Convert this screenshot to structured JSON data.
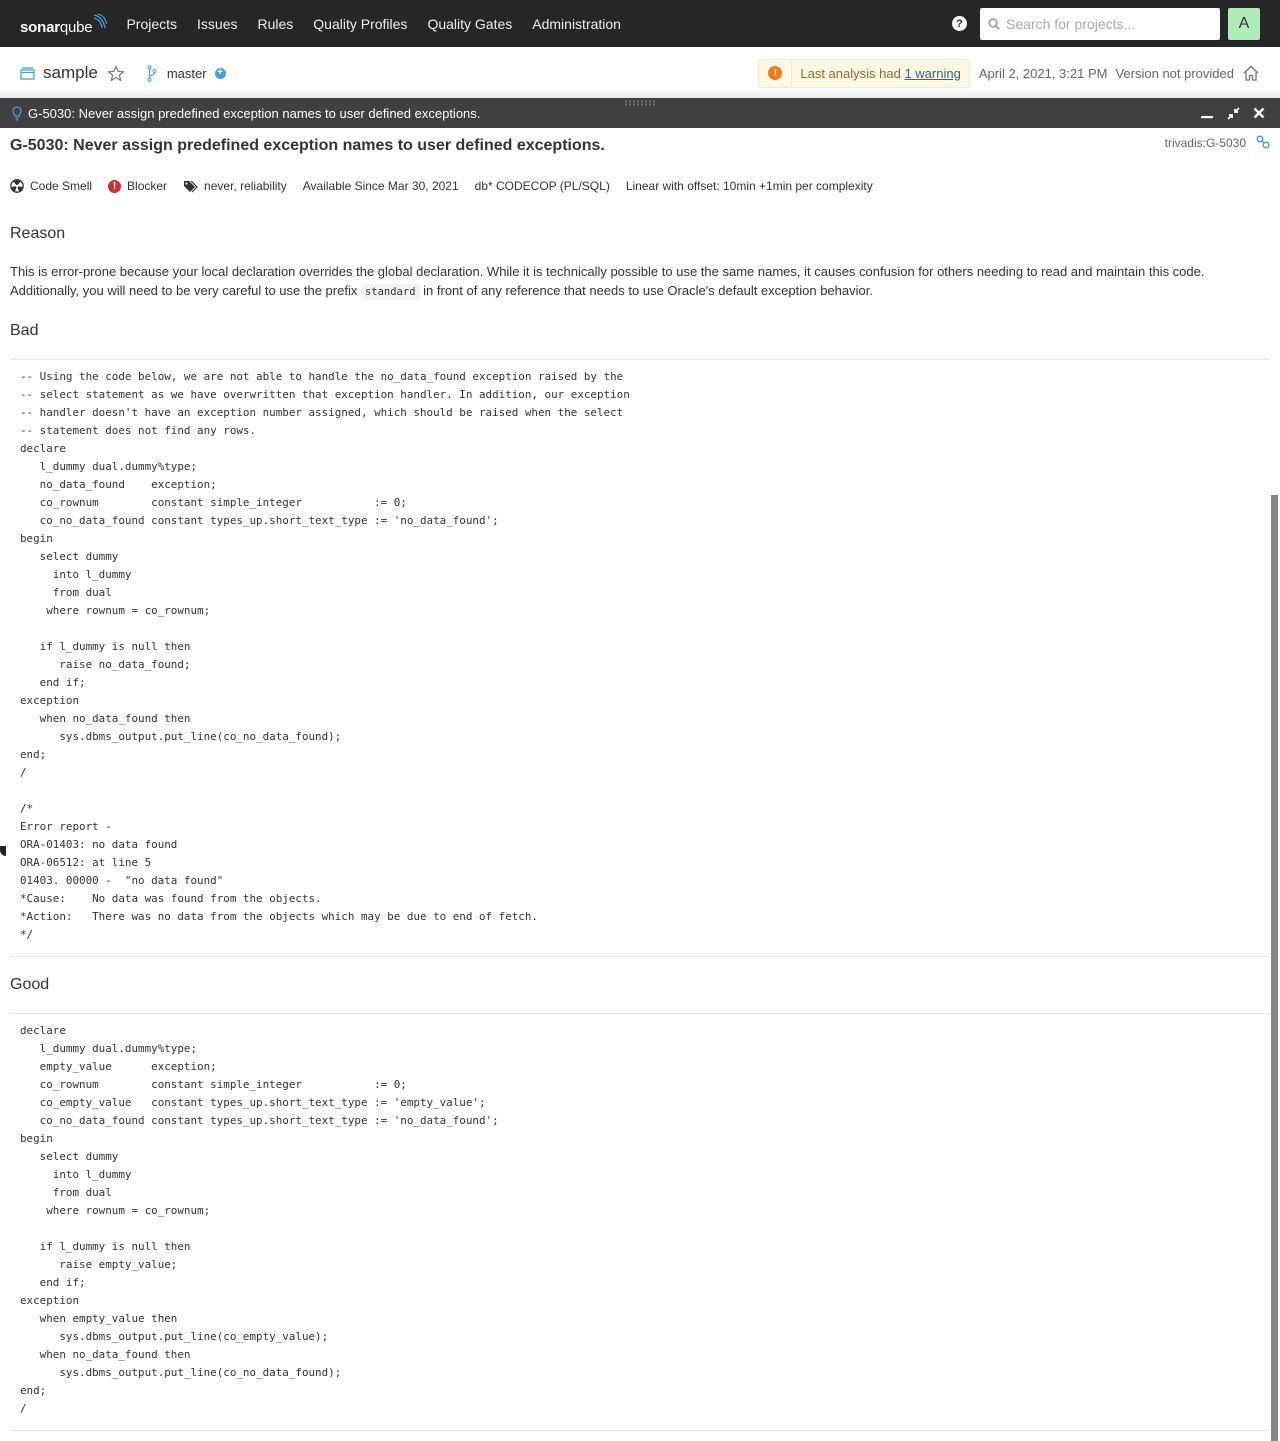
{
  "navbar": {
    "logo_bold": "sonar",
    "logo_light": "qube",
    "links": [
      "Projects",
      "Issues",
      "Rules",
      "Quality Profiles",
      "Quality Gates",
      "Administration"
    ],
    "search_placeholder": "Search for projects...",
    "search_value": "",
    "avatar_letter": "A"
  },
  "project": {
    "name": "sample",
    "branch": "master",
    "warning_prefix": "Last analysis had ",
    "warning_link": "1 warning",
    "analysis_date": "April 2, 2021, 3:21 PM",
    "version": "Version not provided"
  },
  "workspace": {
    "title": "G-5030: Never assign predefined exception names to user defined exceptions."
  },
  "rule": {
    "title": "G-5030: Never assign predefined exception names to user defined exceptions.",
    "key": "trivadis:G-5030",
    "type": "Code Smell",
    "severity": "Blocker",
    "tags": "never, reliability",
    "available_since": "Available Since Mar 30, 2021",
    "repository": "db* CODECOP (PL/SQL)",
    "remediation": "Linear with offset: 10min +1min per complexity",
    "sections": {
      "reason_heading": "Reason",
      "reason_text_1": "This is error-prone because your local declaration overrides the global declaration. While it is technically possible to use the same names, it causes confusion for others needing to read and maintain this code.",
      "reason_text_2a": "Additionally, you will need to be very careful to use the prefix ",
      "reason_code": "standard",
      "reason_text_2b": " in front of any reference that needs to use Oracle's default exception behavior.",
      "bad_heading": "Bad",
      "bad_code": "-- Using the code below, we are not able to handle the no_data_found exception raised by the\n-- select statement as we have overwritten that exception handler. In addition, our exception\n-- handler doesn't have an exception number assigned, which should be raised when the select\n-- statement does not find any rows.\ndeclare\n   l_dummy dual.dummy%type;\n   no_data_found    exception;\n   co_rownum        constant simple_integer           := 0;\n   co_no_data_found constant types_up.short_text_type := 'no_data_found';\nbegin\n   select dummy\n     into l_dummy\n     from dual\n    where rownum = co_rownum;\n\n   if l_dummy is null then\n      raise no_data_found;\n   end if;\nexception\n   when no_data_found then\n      sys.dbms_output.put_line(co_no_data_found);\nend;\n/\n\n/*\nError report -\nORA-01403: no data found\nORA-06512: at line 5\n01403. 00000 -  \"no data found\"\n*Cause:    No data was found from the objects.\n*Action:   There was no data from the objects which may be due to end of fetch.\n*/",
      "good_heading": "Good",
      "good_code": "declare\n   l_dummy dual.dummy%type;\n   empty_value      exception;\n   co_rownum        constant simple_integer           := 0;\n   co_empty_value   constant types_up.short_text_type := 'empty_value';\n   co_no_data_found constant types_up.short_text_type := 'no_data_found';\nbegin\n   select dummy\n     into l_dummy\n     from dual\n    where rownum = co_rownum;\n\n   if l_dummy is null then\n      raise empty_value;\n   end if;\nexception\n   when empty_value then\n      sys.dbms_output.put_line(co_empty_value);\n   when no_data_found then\n      sys.dbms_output.put_line(co_no_data_found);\nend;\n/"
    }
  },
  "icons": {
    "help": "?",
    "warning": "!",
    "plus": "+",
    "blocker": "!"
  },
  "colors": {
    "navbar_bg": "#262626",
    "workspace_bg": "#404040",
    "accent_blue": "#4b9fd5",
    "blocker_red": "#d02f3a",
    "warning_orange": "#ed7d20",
    "avatar_green": "#b0ecb8"
  }
}
